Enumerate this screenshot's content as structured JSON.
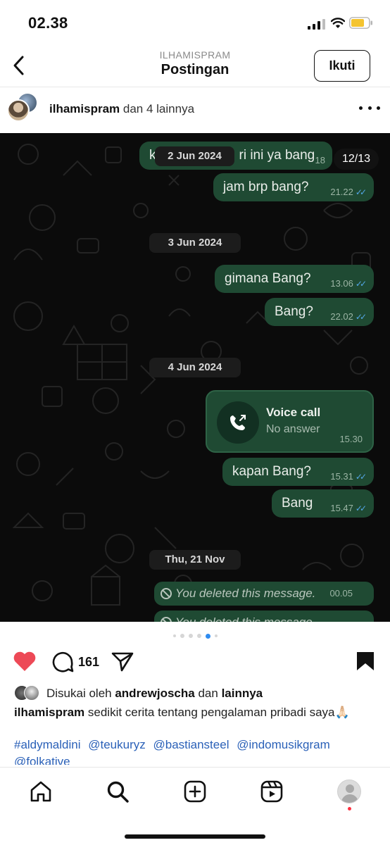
{
  "status_bar": {
    "time": "02.38"
  },
  "header": {
    "subtitle": "ILHAMISPRAM",
    "title": "Postingan",
    "follow_label": "Ikuti"
  },
  "author": {
    "username": "ilhamispram",
    "others": "dan 4 lainnya"
  },
  "post": {
    "counter": "12/13",
    "messages": [
      {
        "text": "k",
        "text_tail": "ri ini ya bang",
        "time": "18"
      },
      {
        "text": "jam brp bang?",
        "time": "21.22"
      },
      {
        "text": "gimana Bang?",
        "time": "13.06"
      },
      {
        "text": "Bang?",
        "time": "22.02"
      },
      {
        "text": "kapan Bang?",
        "time": "15.31"
      },
      {
        "text": "Bang",
        "time": "15.47"
      }
    ],
    "dates": [
      "2 Jun 2024",
      "3 Jun 2024",
      "4 Jun 2024",
      "Thu, 21 Nov"
    ],
    "call": {
      "title": "Voice call",
      "status": "No answer",
      "time": "15.30"
    },
    "deleted": [
      {
        "text": "You deleted this message.",
        "time": "00.05"
      },
      {
        "text": "You deleted this message",
        "time": ""
      }
    ],
    "carousel": {
      "total_dots": 6,
      "active_index": 4
    }
  },
  "actions": {
    "comment_count": "161"
  },
  "likes": {
    "prefix": "Disukai oleh",
    "user": "andrewjoscha",
    "connector": "dan",
    "rest": "lainnya"
  },
  "caption": {
    "username": "ilhamispram",
    "text": "sedikit cerita tentang pengalaman pribadi saya🙏🏻",
    "tags": [
      "#aldymaldini",
      "@teukuryz",
      "@bastiansteel",
      "@indomusikgram",
      "@folkative"
    ]
  },
  "colors": {
    "bubble": "#1f4a33",
    "like_red": "#ed4956",
    "link_blue": "#2b61b8",
    "active_dot": "#2f8cf0",
    "read_ticks": "#53a7e8"
  },
  "icons": {
    "back": "chevron-left-icon",
    "more": "more-horizontal-icon",
    "like": "heart-filled-icon",
    "comment": "comment-icon",
    "share": "send-icon",
    "save": "bookmark-filled-icon",
    "nav": [
      "home-icon",
      "search-icon",
      "create-icon",
      "reels-icon",
      "profile-avatar"
    ]
  }
}
